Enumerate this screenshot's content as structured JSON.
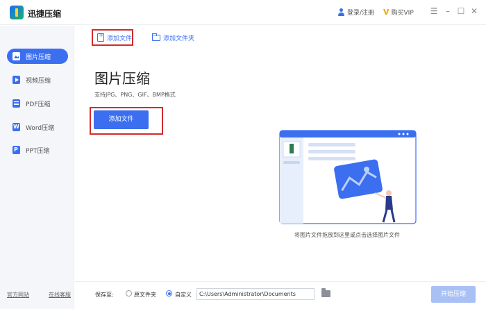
{
  "app": {
    "title": "迅捷压缩"
  },
  "header": {
    "login_label": "登录/注册",
    "vip_label": "购买VIP"
  },
  "sidebar": {
    "items": [
      {
        "label": "图片压缩",
        "active": true
      },
      {
        "label": "视频压缩"
      },
      {
        "label": "PDF压缩"
      },
      {
        "label": "Word压缩"
      },
      {
        "label": "PPT压缩"
      }
    ],
    "official_site": "官方网站",
    "online_service": "在线客服"
  },
  "toolbar": {
    "add_file": "添加文件",
    "add_folder": "添加文件夹"
  },
  "main": {
    "title": "图片压缩",
    "formats": "支持JPG、PNG、GIF、BMP格式",
    "add_button": "添加文件",
    "drop_hint": "将图片文件拖放到这里或点击选择图片文件"
  },
  "footer": {
    "save_to": "保存至:",
    "option_original": "原文件夹",
    "option_custom": "自定义",
    "selected_option": "自定义",
    "path": "C:\\Users\\Administrator\\Documents",
    "start_button": "开始压缩"
  },
  "colors": {
    "accent": "#3b6ff0",
    "highlight": "#d32a2a",
    "disabled": "#a9c0f5"
  }
}
